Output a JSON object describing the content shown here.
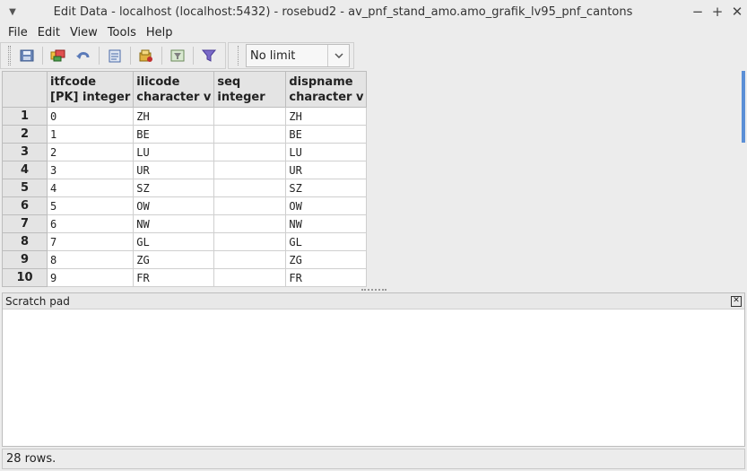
{
  "window": {
    "title": "Edit Data - localhost (localhost:5432) - rosebud2 - av_pnf_stand_amo.amo_grafik_lv95_pnf_cantons",
    "minimize": "−",
    "maximize": "+",
    "close": "✕"
  },
  "menu": [
    "File",
    "Edit",
    "View",
    "Tools",
    "Help"
  ],
  "toolbar": {
    "icons": [
      "save-icon",
      "copy-icon",
      "undo-icon",
      "paste-icon",
      "delete-icon",
      "filter-icon",
      "sort-filter-icon"
    ],
    "limit_value": "No limit"
  },
  "grid": {
    "columns": [
      {
        "name": "itfcode",
        "type": "[PK] integer"
      },
      {
        "name": "ilicode",
        "type": "character v"
      },
      {
        "name": "seq",
        "type": "integer"
      },
      {
        "name": "dispname",
        "type": "character v"
      }
    ],
    "rows": [
      {
        "num": "1",
        "itfcode": "0",
        "ilicode": "ZH",
        "seq": "",
        "dispname": "ZH"
      },
      {
        "num": "2",
        "itfcode": "1",
        "ilicode": "BE",
        "seq": "",
        "dispname": "BE"
      },
      {
        "num": "3",
        "itfcode": "2",
        "ilicode": "LU",
        "seq": "",
        "dispname": "LU"
      },
      {
        "num": "4",
        "itfcode": "3",
        "ilicode": "UR",
        "seq": "",
        "dispname": "UR"
      },
      {
        "num": "5",
        "itfcode": "4",
        "ilicode": "SZ",
        "seq": "",
        "dispname": "SZ"
      },
      {
        "num": "6",
        "itfcode": "5",
        "ilicode": "OW",
        "seq": "",
        "dispname": "OW"
      },
      {
        "num": "7",
        "itfcode": "6",
        "ilicode": "NW",
        "seq": "",
        "dispname": "NW"
      },
      {
        "num": "8",
        "itfcode": "7",
        "ilicode": "GL",
        "seq": "",
        "dispname": "GL"
      },
      {
        "num": "9",
        "itfcode": "8",
        "ilicode": "ZG",
        "seq": "",
        "dispname": "ZG"
      },
      {
        "num": "10",
        "itfcode": "9",
        "ilicode": "FR",
        "seq": "",
        "dispname": "FR"
      }
    ]
  },
  "scratch": {
    "label": "Scratch pad",
    "close": "✕"
  },
  "status": {
    "text": "28 rows."
  },
  "colors": {
    "scroll": "#5b8fd6"
  }
}
